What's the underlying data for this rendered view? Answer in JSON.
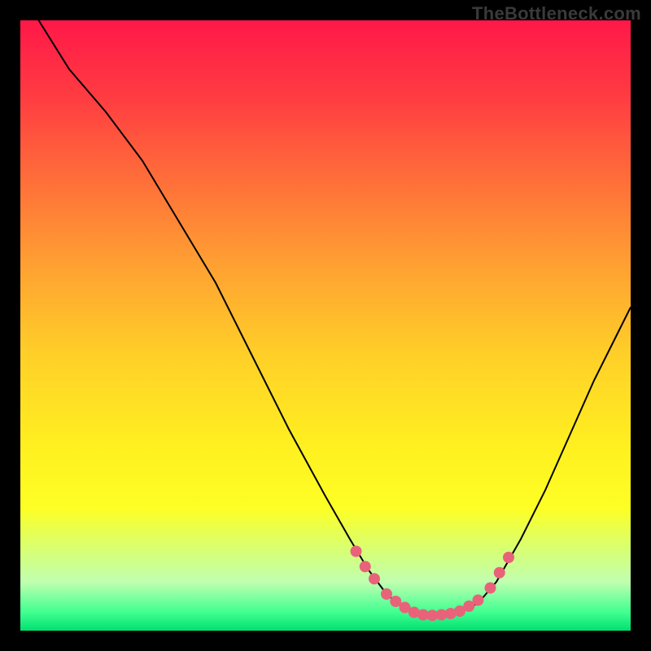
{
  "watermark": "TheBottleneck.com",
  "chart_data": {
    "type": "line",
    "title": "",
    "xlabel": "",
    "ylabel": "",
    "xlim": [
      0,
      100
    ],
    "ylim": [
      0,
      100
    ],
    "curve_left": [
      {
        "x": 3,
        "y": 100
      },
      {
        "x": 8,
        "y": 92
      },
      {
        "x": 14,
        "y": 85
      },
      {
        "x": 20,
        "y": 77
      },
      {
        "x": 26,
        "y": 67
      },
      {
        "x": 32,
        "y": 57
      },
      {
        "x": 38,
        "y": 45
      },
      {
        "x": 44,
        "y": 33
      },
      {
        "x": 50,
        "y": 22
      },
      {
        "x": 54,
        "y": 15
      },
      {
        "x": 57,
        "y": 10
      },
      {
        "x": 60,
        "y": 6
      },
      {
        "x": 63,
        "y": 3.5
      },
      {
        "x": 66,
        "y": 2.5
      },
      {
        "x": 69,
        "y": 2.5
      },
      {
        "x": 72,
        "y": 3
      },
      {
        "x": 75,
        "y": 4.5
      }
    ],
    "curve_right": [
      {
        "x": 75,
        "y": 4.5
      },
      {
        "x": 78,
        "y": 8
      },
      {
        "x": 82,
        "y": 15
      },
      {
        "x": 86,
        "y": 23
      },
      {
        "x": 90,
        "y": 32
      },
      {
        "x": 94,
        "y": 41
      },
      {
        "x": 98,
        "y": 49
      },
      {
        "x": 100,
        "y": 53
      }
    ],
    "markers": [
      {
        "x": 55,
        "y": 13
      },
      {
        "x": 56.5,
        "y": 10.5
      },
      {
        "x": 58,
        "y": 8.5
      },
      {
        "x": 60,
        "y": 6
      },
      {
        "x": 61.5,
        "y": 4.8
      },
      {
        "x": 63,
        "y": 3.8
      },
      {
        "x": 64.5,
        "y": 3
      },
      {
        "x": 66,
        "y": 2.6
      },
      {
        "x": 67.5,
        "y": 2.5
      },
      {
        "x": 69,
        "y": 2.6
      },
      {
        "x": 70.5,
        "y": 2.8
      },
      {
        "x": 72,
        "y": 3.2
      },
      {
        "x": 73.5,
        "y": 4
      },
      {
        "x": 75,
        "y": 5
      },
      {
        "x": 77,
        "y": 7
      },
      {
        "x": 78.5,
        "y": 9.5
      },
      {
        "x": 80,
        "y": 12
      }
    ],
    "marker_color": "#e8637a",
    "marker_radius": 7,
    "line_color": "#000000",
    "line_width": 2
  }
}
